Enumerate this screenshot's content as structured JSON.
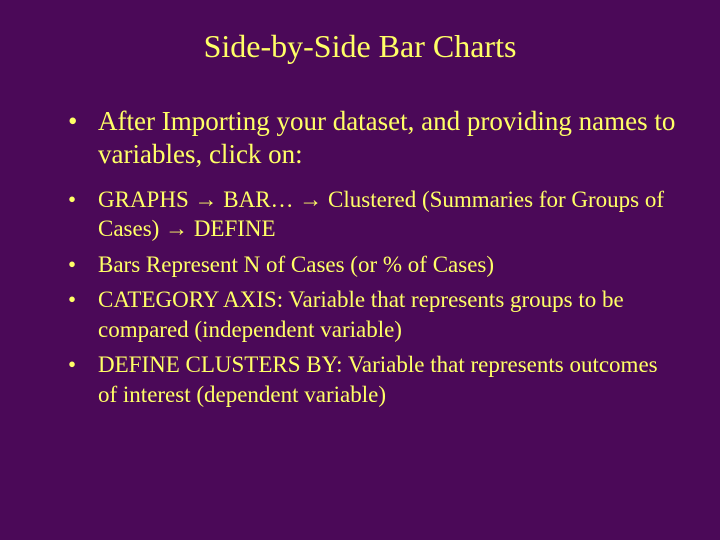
{
  "title": "Side-by-Side Bar Charts",
  "bullets_top": [
    "After Importing your dataset, and providing names to variables, click on:"
  ],
  "bullets_sub": [
    "GRAPHS → BAR… → Clustered (Summaries for Groups of Cases) → DEFINE",
    "Bars Represent N of Cases (or % of Cases)",
    "CATEGORY AXIS: Variable that represents groups to be compared (independent variable)",
    "DEFINE CLUSTERS BY: Variable that represents outcomes of interest (dependent variable)"
  ]
}
